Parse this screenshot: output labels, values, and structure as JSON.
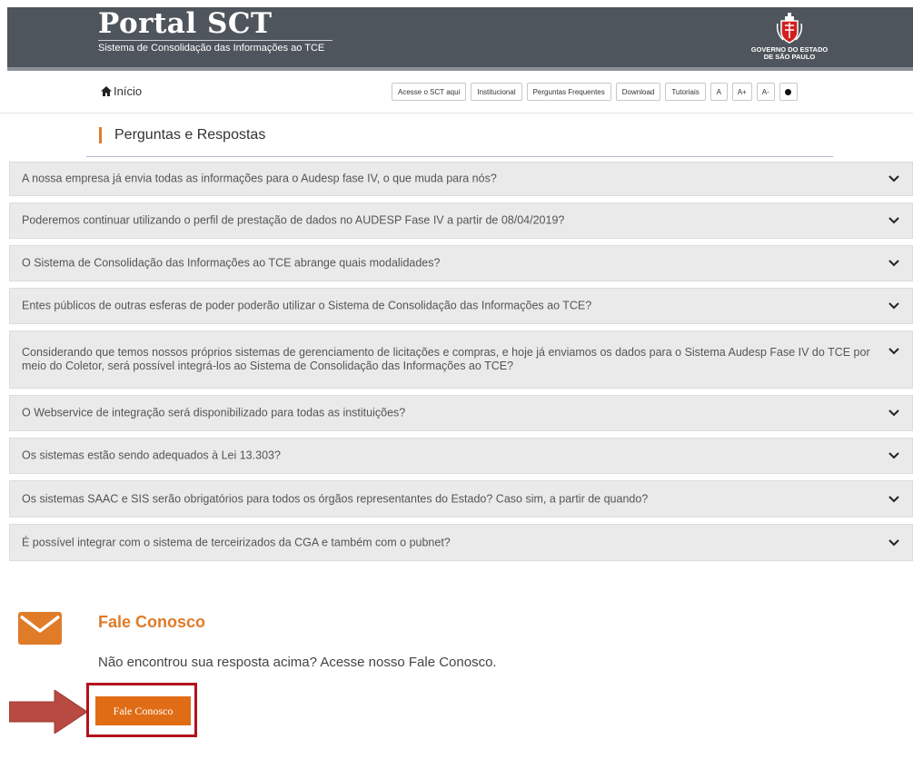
{
  "header": {
    "title": "Portal SCT",
    "subtitle": "Sistema de Consolidação das Informações ao TCE",
    "gov_line1": "GOVERNO DO ESTADO",
    "gov_line2": "DE SÃO PAULO"
  },
  "nav": {
    "home_label": "Início",
    "buttons": [
      "Acesse o SCT aqui",
      "Institucional",
      "Perguntas Frequentes",
      "Download",
      "Tutoriais",
      "A",
      "A+",
      "A-"
    ]
  },
  "section": {
    "title": "Perguntas e Respostas"
  },
  "faq": [
    "A nossa empresa já envia todas as informações para o Audesp fase IV, o que muda para nós?",
    "Poderemos continuar utilizando o perfil de prestação de dados no AUDESP Fase IV a partir de 08/04/2019?",
    "O Sistema de Consolidação das Informações ao TCE abrange quais modalidades?",
    "Entes públicos de outras esferas de poder poderão utilizar o Sistema de Consolidação das Informações ao TCE?",
    "Considerando que temos nossos próprios sistemas de gerenciamento de licitações e compras, e hoje já enviamos os dados para o Sistema Audesp Fase IV do TCE por meio do Coletor, será possível integrá-los ao Sistema de Consolidação das Informações ao TCE?",
    "O Webservice de integração será disponibilizado para todas as instituições?",
    "Os sistemas estão sendo adequados à Lei 13.303?",
    "Os sistemas SAAC e SIS serão obrigatórios para todos os órgãos representantes do Estado? Caso sim, a partir de quando?",
    "É possível integrar com o sistema de terceirizados da CGA e também com o pubnet?"
  ],
  "contact": {
    "title": "Fale Conosco",
    "text": "Não encontrou sua resposta acima? Acesse nosso Fale Conosco.",
    "button_label": "Fale Conosco"
  },
  "colors": {
    "header_bg": "#4f555c",
    "accent": "#e07b28",
    "button_bg": "#e06d16",
    "highlight_border": "#b2121b",
    "arrow": "#b84a42"
  }
}
